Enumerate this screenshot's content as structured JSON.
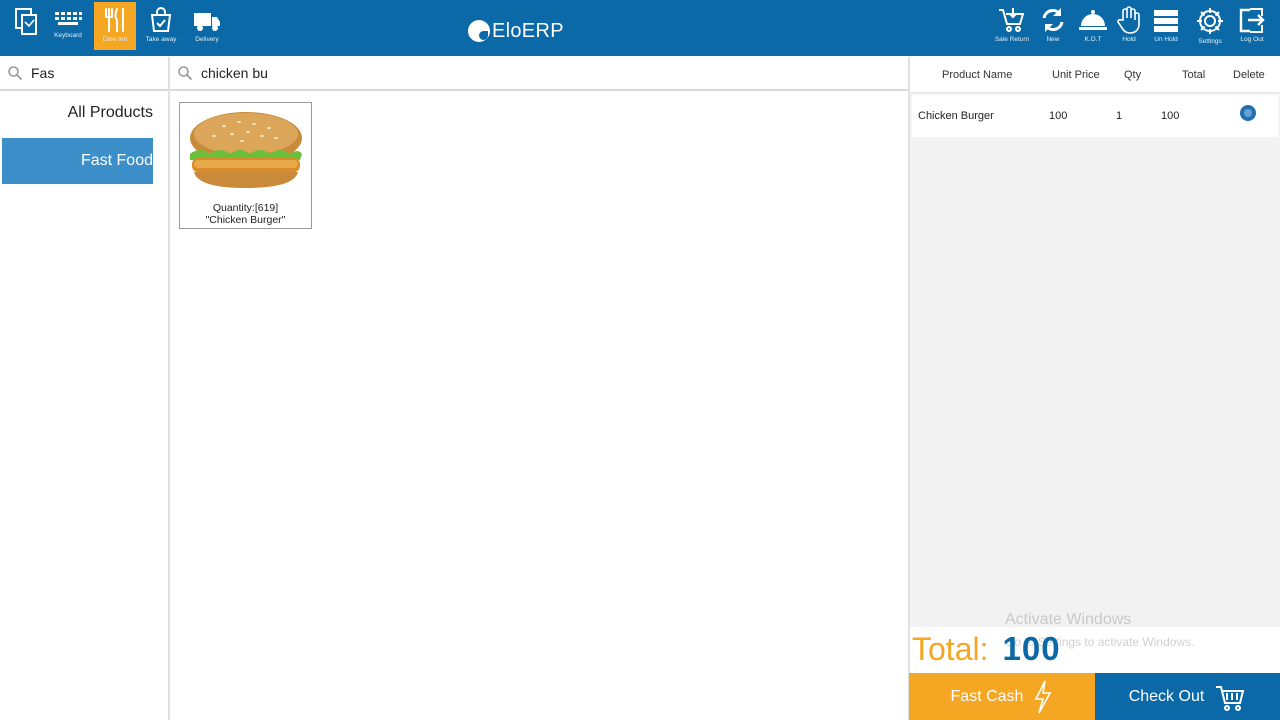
{
  "app": {
    "logo_text": "EloERP"
  },
  "toolbar_left": [
    {
      "name": "copy-button",
      "icon": "copy-icon",
      "label": ""
    },
    {
      "name": "keyboard-button",
      "icon": "keyboard-icon",
      "label": "Keyboard"
    },
    {
      "name": "dine-in-button",
      "icon": "cutlery-icon",
      "label": "Dine Inn",
      "active": true
    },
    {
      "name": "take-away-button",
      "icon": "takeaway-icon",
      "label": "Take away"
    },
    {
      "name": "delivery-button",
      "icon": "truck-icon",
      "label": "Delivery"
    }
  ],
  "toolbar_right": [
    {
      "name": "sale-return-button",
      "icon": "cart-return-icon",
      "label": "Sale Return"
    },
    {
      "name": "new-button",
      "icon": "refresh-icon",
      "label": "New"
    },
    {
      "name": "kot-button",
      "icon": "cloche-icon",
      "label": "K.O.T"
    },
    {
      "name": "hold-button",
      "icon": "hand-icon",
      "label": "Hold"
    },
    {
      "name": "unhold-button",
      "icon": "stack-icon",
      "label": "Un Hold"
    },
    {
      "name": "settings-button",
      "icon": "gear-icon",
      "label": "Settings"
    },
    {
      "name": "logout-button",
      "icon": "logout-icon",
      "label": "Log Out"
    }
  ],
  "category_search": {
    "value": "Fas"
  },
  "product_search": {
    "value": "chicken bu"
  },
  "categories": [
    {
      "label": "All Products",
      "active": false
    },
    {
      "label": "Fast Food",
      "active": true
    }
  ],
  "products": [
    {
      "quantity_text": "Quantity:[619]",
      "name": "\"Chicken Burger\""
    }
  ],
  "order": {
    "headers": {
      "product": "Product Name",
      "unit_price": "Unit Price",
      "qty": "Qty",
      "total": "Total",
      "delete": "Delete"
    },
    "rows": [
      {
        "product": "Chicken Burger",
        "unit_price": "100",
        "qty": "1",
        "total": "100"
      }
    ]
  },
  "watermark": {
    "line1": "Activate Windows",
    "line2": "Go to Settings to activate Windows."
  },
  "summary": {
    "total_label": "Total:",
    "total_value": "100"
  },
  "actions": {
    "fast_cash": "Fast Cash",
    "check_out": "Check Out"
  },
  "colors": {
    "brand": "#0a69a6",
    "accent": "#f5a623",
    "category_active": "#3d8fc9"
  }
}
